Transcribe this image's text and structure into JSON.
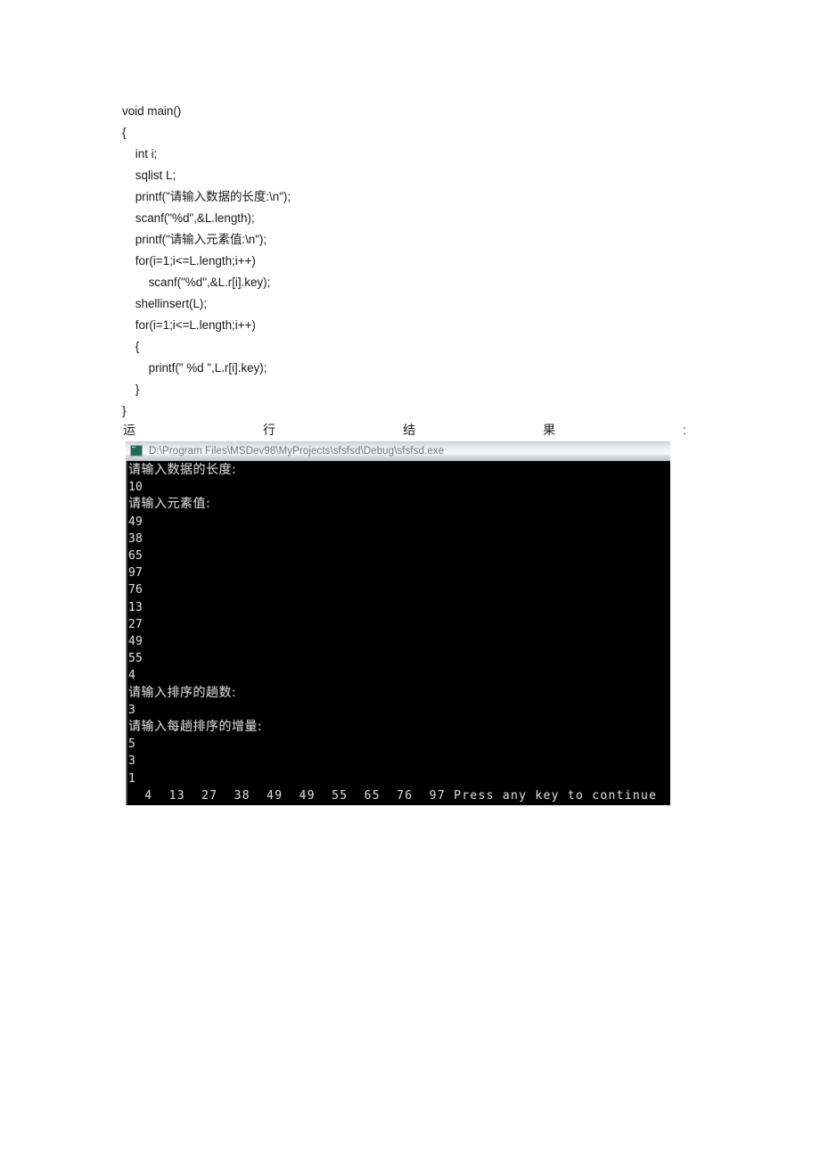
{
  "document": {
    "code_listing": [
      "void main()",
      "{",
      "    int i;",
      "    sqlist L;",
      "    printf(\"请输入数据的长度:\\n\");",
      "    scanf(\"%d\",&L.length);",
      "    printf(\"请输入元素值:\\n\");",
      "    for(i=1;i<=L.length;i++)",
      "        scanf(\"%d\",&L.r[i].key);",
      "    shellinsert(L);",
      "    for(i=1;i<=L.length;i++)",
      "    {",
      "        printf(\" %d \",L.r[i].key);",
      "    }",
      "}"
    ],
    "result_caption": {
      "char1": "运",
      "char2": "行",
      "char3": "结",
      "char4": "果",
      "colon": ":"
    }
  },
  "console": {
    "title": "D:\\Program Files\\MSDev98\\MyProjects\\sfsfsd\\Debug\\sfsfsd.exe",
    "icon": "console-app-icon",
    "background_color": "#000000",
    "text_color": "#d4d4d4",
    "titlebar_color": "#eef2f6",
    "output_lines": [
      "请输入数据的长度:",
      "10",
      "请输入元素值:",
      "49",
      "38",
      "65",
      "97",
      "76",
      "13",
      "27",
      "49",
      "55",
      "4",
      "请输入排序的趟数:",
      "3",
      "请输入每趟排序的增量:",
      "5",
      "3",
      "1",
      "  4  13  27  38  49  49  55  65  76  97 Press any key to continue"
    ],
    "unsorted_input": [
      49,
      38,
      65,
      97,
      76,
      13,
      27,
      49,
      55,
      4
    ],
    "data_length": "10",
    "pass_count": "3",
    "increments": [
      5,
      3,
      1
    ],
    "sorted_output": [
      4,
      13,
      27,
      38,
      49,
      49,
      55,
      65,
      76,
      97
    ],
    "press_any_key": "Press any key to continue"
  }
}
